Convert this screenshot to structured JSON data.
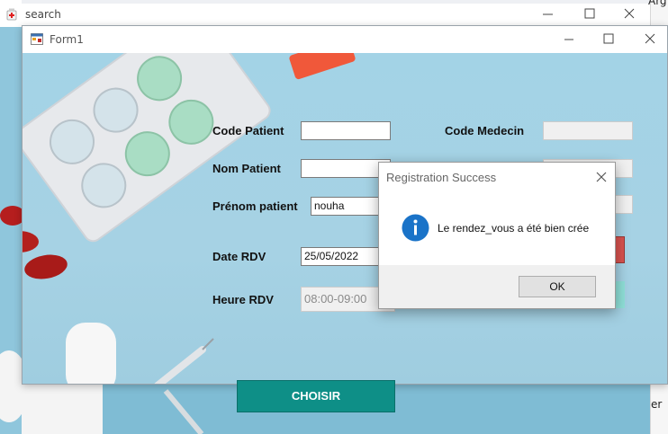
{
  "background_window": {
    "title": "search",
    "top_strip_text": "Arg",
    "right_edge_text": "er"
  },
  "form1": {
    "title": "Form1",
    "labels": {
      "code_patient": "Code Patient",
      "code_medecin": "Code Medecin",
      "nom_patient": "Nom Patient",
      "prenom_patient": "Prénom patient",
      "date_rdv": "Date RDV",
      "heure_rdv": "Heure RDV"
    },
    "fields": {
      "code_patient": "",
      "code_medecin": "",
      "nom_patient": "",
      "prenom_patient": "nouha",
      "date_rdv": "25/05/2022",
      "heure_rdv": "08:00-09:00"
    },
    "choisir_button": "CHOISIR"
  },
  "dialog": {
    "title": "Registration Success",
    "message": "Le rendez_vous a été bien crée",
    "ok_button": "OK"
  },
  "colors": {
    "form_background": "#a9d4e6",
    "choisir_button": "#0e8f87",
    "info_icon": "#1a73c8",
    "red_button": "#d9534f",
    "teal_button": "#8fe0d8"
  }
}
